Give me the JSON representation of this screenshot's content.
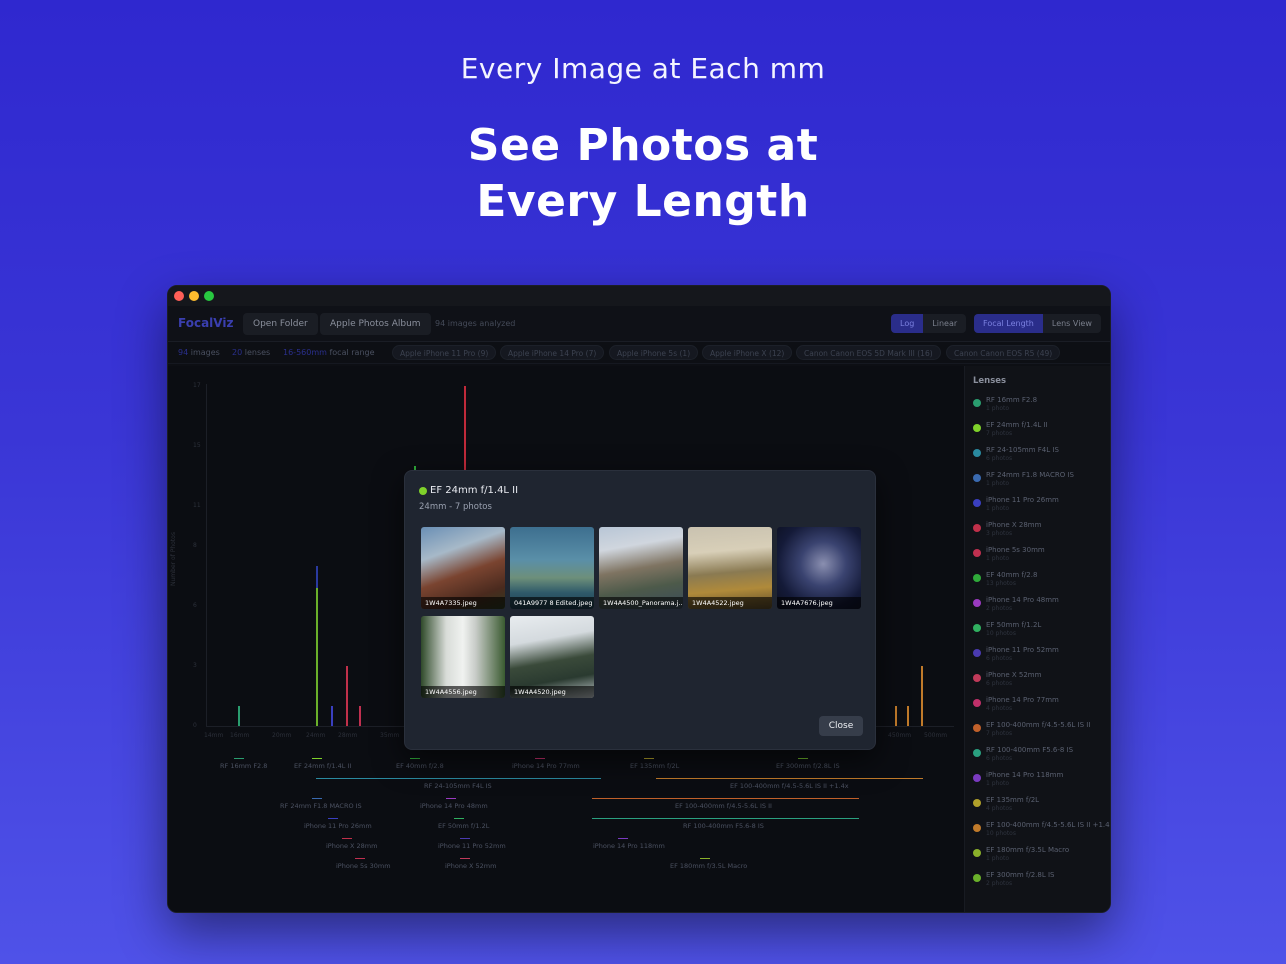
{
  "hero": {
    "subtitle": "Every Image at Each mm",
    "title_line1": "See Photos at",
    "title_line2": "Every Length"
  },
  "colors": {
    "background_top": "#2f28cf",
    "background_bottom": "#4f52e8",
    "window_bg": "#0d0f14",
    "accent": "#2a2d8a",
    "modal_dot": "#7fd12a"
  },
  "toolbar": {
    "brand": "FocalViz",
    "open_folder": "Open Folder",
    "apple_photos": "Apple Photos Album",
    "analyzed": "94 images analyzed",
    "scale_log": "Log",
    "scale_linear": "Linear",
    "view_focal": "Focal Length",
    "view_lens": "Lens View"
  },
  "stats": {
    "images_count": "94",
    "images_label": "images",
    "lenses_count": "20",
    "lenses_label": "lenses",
    "range_value": "16-560mm",
    "range_label": "focal range"
  },
  "chips": [
    "Apple iPhone 11 Pro (9)",
    "Apple iPhone 14 Pro (7)",
    "Apple iPhone 5s (1)",
    "Apple iPhone X (12)",
    "Canon Canon EOS 5D Mark III (16)",
    "Canon Canon EOS R5 (49)"
  ],
  "chart": {
    "ylabel": "Number of Photos",
    "yticks": [
      "17",
      "15",
      "11",
      "8",
      "6",
      "3",
      "0"
    ],
    "xticks": [
      "14mm",
      "16mm",
      "20mm",
      "24mm",
      "28mm",
      "35mm",
      "450mm",
      "500mm"
    ],
    "range_labels": [
      "RF 16mm F2.8",
      "EF 24mm f/1.4L II",
      "EF 40mm f/2.8",
      "iPhone 14 Pro 77mm",
      "EF 135mm f/2L",
      "EF 300mm f/2.8L IS",
      "RF 24-105mm F4L IS",
      "EF 100-400mm f/4.5-5.6L IS II +1.4x",
      "RF 24mm F1.8 MACRO IS",
      "iPhone 14 Pro 48mm",
      "EF 100-400mm f/4.5-5.6L IS II",
      "iPhone 11 Pro 26mm",
      "EF 50mm f/1.2L",
      "RF 100-400mm F5.6-8 IS",
      "iPhone X 28mm",
      "iPhone 11 Pro 52mm",
      "iPhone 14 Pro 118mm",
      "iPhone 5s 30mm",
      "iPhone X 52mm",
      "EF 180mm f/3.5L Macro"
    ]
  },
  "sidebar": {
    "title": "Lenses",
    "lenses": [
      {
        "name": "RF 16mm F2.8",
        "count": "1 photo",
        "color": "#2a9d6f"
      },
      {
        "name": "EF 24mm f/1.4L II",
        "count": "7 photos",
        "color": "#7fd12a"
      },
      {
        "name": "RF 24-105mm F4L IS",
        "count": "6 photos",
        "color": "#2a8aa0"
      },
      {
        "name": "RF 24mm F1.8 MACRO IS",
        "count": "1 photo",
        "color": "#3a6ab0"
      },
      {
        "name": "iPhone 11 Pro 26mm",
        "count": "1 photo",
        "color": "#3a3fc0"
      },
      {
        "name": "iPhone X 28mm",
        "count": "3 photos",
        "color": "#c0304a"
      },
      {
        "name": "iPhone 5s 30mm",
        "count": "1 photo",
        "color": "#c03050"
      },
      {
        "name": "EF 40mm f/2.8",
        "count": "13 photos",
        "color": "#2faa3a"
      },
      {
        "name": "iPhone 14 Pro 48mm",
        "count": "2 photos",
        "color": "#9a3ac0"
      },
      {
        "name": "EF 50mm f/1.2L",
        "count": "10 photos",
        "color": "#30b060"
      },
      {
        "name": "iPhone 11 Pro 52mm",
        "count": "6 photos",
        "color": "#4a3ab0"
      },
      {
        "name": "iPhone X 52mm",
        "count": "6 photos",
        "color": "#c03a5a"
      },
      {
        "name": "iPhone 14 Pro 77mm",
        "count": "4 photos",
        "color": "#c0306a"
      },
      {
        "name": "EF 100-400mm f/4.5-5.6L IS II",
        "count": "7 photos",
        "color": "#c0602a"
      },
      {
        "name": "RF 100-400mm F5.6-8 IS",
        "count": "6 photos",
        "color": "#2aa080"
      },
      {
        "name": "iPhone 14 Pro 118mm",
        "count": "1 photo",
        "color": "#7a3ac0"
      },
      {
        "name": "EF 135mm f/2L",
        "count": "4 photos",
        "color": "#b0a02a"
      },
      {
        "name": "EF 100-400mm f/4.5-5.6L IS II +1.4x",
        "count": "10 photos",
        "color": "#c07a2a"
      },
      {
        "name": "EF 180mm f/3.5L Macro",
        "count": "1 photo",
        "color": "#8ab02a"
      },
      {
        "name": "EF 300mm f/2.8L IS",
        "count": "2 photos",
        "color": "#6ab02a"
      }
    ]
  },
  "modal": {
    "title": "EF 24mm f/1.4L II",
    "subtitle": "24mm - 7 photos",
    "close": "Close",
    "photos": [
      "1W4A7335.jpeg",
      "041A9977 8 Edited.jpeg",
      "1W4A4500_Panorama.j...",
      "1W4A4522.jpeg",
      "1W4A7676.jpeg",
      "1W4A4556.jpeg",
      "1W4A4520.jpeg"
    ]
  }
}
